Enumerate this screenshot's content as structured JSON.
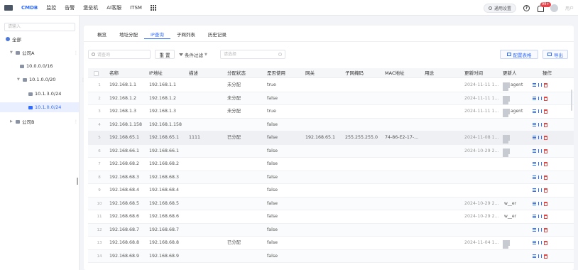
{
  "topnav": {
    "items": [
      {
        "label": "CMDB",
        "active": true
      },
      {
        "label": "监控",
        "active": false
      },
      {
        "label": "告警",
        "active": false
      },
      {
        "label": "堡垒机",
        "active": false
      },
      {
        "label": "AI客服",
        "active": false
      },
      {
        "label": "ITSM",
        "active": false
      }
    ],
    "settings_label": "通用设置",
    "notification_count": "99+",
    "username": "用户"
  },
  "sidebar": {
    "search_placeholder": "请输入",
    "tree": [
      {
        "label": "全部",
        "level": 0
      },
      {
        "label": "公司A",
        "level": 1
      },
      {
        "label": "10.0.0.0/16",
        "level": 2
      },
      {
        "label": "10.1.0.0/20",
        "level": 2
      },
      {
        "label": "10.1.3.0/24",
        "level": 3
      },
      {
        "label": "10.1.0.0/24",
        "level": 3,
        "selected": true
      },
      {
        "label": "公司B",
        "level": 1
      }
    ]
  },
  "tabs": [
    {
      "label": "概览",
      "active": false
    },
    {
      "label": "地址分配",
      "active": false
    },
    {
      "label": "IP查询",
      "active": true
    },
    {
      "label": "子网列表",
      "active": false
    },
    {
      "label": "历史记录",
      "active": false
    }
  ],
  "toolbar": {
    "search_placeholder": "请查询",
    "reset_label": "重 置",
    "filter_label": "条件过滤",
    "value_placeholder": "请选择",
    "config_label": "配置表格",
    "export_label": "导出"
  },
  "table": {
    "headers": {
      "name": "名称",
      "ip": "IP地址",
      "desc": "描述",
      "status": "分配状态",
      "used": "是否使用",
      "gateway": "网关",
      "mask": "子网掩码",
      "mac": "MAC地址",
      "purpose": "用途",
      "updated": "更新时间",
      "updater": "更新人",
      "ops": "操作"
    },
    "rows": [
      {
        "idx": "1",
        "name": "192.168.1.1",
        "ip": "192.168.1.1",
        "desc": "",
        "status": "未分配",
        "used": "true",
        "gateway": "",
        "mask": "",
        "mac": "",
        "purpose": "",
        "updated": "2024-11-11 1...",
        "updater": "agent",
        "updater_mark": true
      },
      {
        "idx": "2",
        "name": "192.168.1.2",
        "ip": "192.168.1.2",
        "desc": "",
        "status": "未分配",
        "used": "false",
        "gateway": "",
        "mask": "",
        "mac": "",
        "purpose": "",
        "updated": "2024-11-11 1...",
        "updater": "",
        "updater_mark": true
      },
      {
        "idx": "3",
        "name": "192.168.1.3",
        "ip": "192.168.1.3",
        "desc": "",
        "status": "未分配",
        "used": "true",
        "gateway": "",
        "mask": "",
        "mac": "",
        "purpose": "",
        "updated": "2024-11-11 1...",
        "updater": "agent",
        "updater_mark": true
      },
      {
        "idx": "4",
        "name": "192.168.1.158",
        "ip": "192.168.1.158",
        "desc": "",
        "status": "",
        "used": "false",
        "gateway": "",
        "mask": "",
        "mac": "",
        "purpose": "",
        "updated": "",
        "updater": "",
        "updater_mark": false
      },
      {
        "idx": "5",
        "name": "192.168.65.1",
        "ip": "192.168.65.1",
        "desc": "1111",
        "status": "已分配",
        "used": "false",
        "gateway": "192.168.65.1",
        "mask": "255.255.255.0",
        "mac": "74-86-E2-17-...",
        "purpose": "",
        "updated": "2024-11-08 1...",
        "updater": "",
        "updater_mark": true
      },
      {
        "idx": "6",
        "name": "192.168.66.1",
        "ip": "192.168.66.1",
        "desc": "",
        "status": "",
        "used": "false",
        "gateway": "",
        "mask": "",
        "mac": "",
        "purpose": "",
        "updated": "2024-10-29 2...",
        "updater": "",
        "updater_mark": true
      },
      {
        "idx": "7",
        "name": "192.168.68.2",
        "ip": "192.168.68.2",
        "desc": "",
        "status": "",
        "used": "false",
        "gateway": "",
        "mask": "",
        "mac": "",
        "purpose": "",
        "updated": "",
        "updater": "",
        "updater_mark": false
      },
      {
        "idx": "8",
        "name": "192.168.68.3",
        "ip": "192.168.68.3",
        "desc": "",
        "status": "",
        "used": "false",
        "gateway": "",
        "mask": "",
        "mac": "",
        "purpose": "",
        "updated": "",
        "updater": "",
        "updater_mark": false
      },
      {
        "idx": "9",
        "name": "192.168.68.4",
        "ip": "192.168.68.4",
        "desc": "",
        "status": "",
        "used": "false",
        "gateway": "",
        "mask": "",
        "mac": "",
        "purpose": "",
        "updated": "",
        "updater": "",
        "updater_mark": false
      },
      {
        "idx": "10",
        "name": "192.168.68.5",
        "ip": "192.168.68.5",
        "desc": "",
        "status": "",
        "used": "false",
        "gateway": "",
        "mask": "",
        "mac": "",
        "purpose": "",
        "updated": "2024-10-29 2...",
        "updater": "w__er",
        "updater_mark": false
      },
      {
        "idx": "11",
        "name": "192.168.68.6",
        "ip": "192.168.68.6",
        "desc": "",
        "status": "",
        "used": "false",
        "gateway": "",
        "mask": "",
        "mac": "",
        "purpose": "",
        "updated": "2024-10-29 2...",
        "updater": "w__er",
        "updater_mark": false
      },
      {
        "idx": "12",
        "name": "192.168.68.7",
        "ip": "192.168.68.7",
        "desc": "",
        "status": "",
        "used": "false",
        "gateway": "",
        "mask": "",
        "mac": "",
        "purpose": "",
        "updated": "",
        "updater": "",
        "updater_mark": false
      },
      {
        "idx": "13",
        "name": "192.168.68.8",
        "ip": "192.168.68.8",
        "desc": "",
        "status": "已分配",
        "used": "false",
        "gateway": "",
        "mask": "",
        "mac": "",
        "purpose": "",
        "updated": "2024-11-04 1...",
        "updater": "",
        "updater_mark": true
      },
      {
        "idx": "14",
        "name": "192.168.68.9",
        "ip": "192.168.68.9",
        "desc": "",
        "status": "",
        "used": "false",
        "gateway": "",
        "mask": "",
        "mac": "",
        "purpose": "",
        "updated": "",
        "updater": "",
        "updater_mark": false
      }
    ]
  }
}
